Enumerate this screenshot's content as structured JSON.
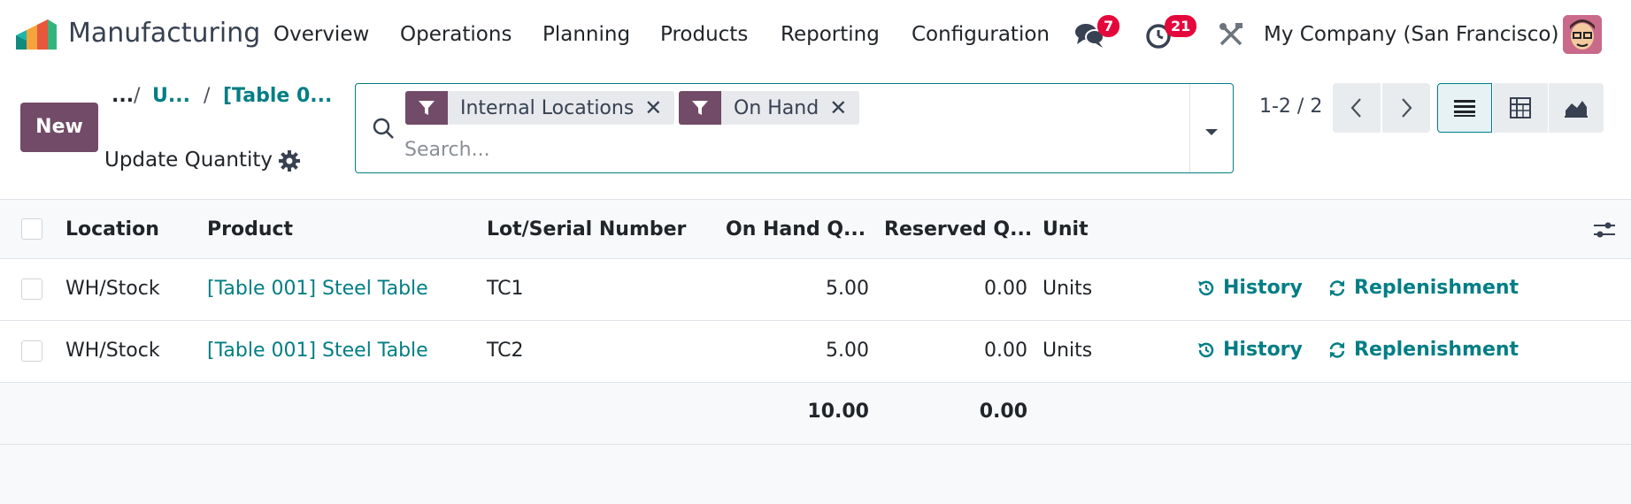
{
  "app": {
    "title": "Manufacturing",
    "accent": "#714b67",
    "link_color": "#017e84"
  },
  "nav": {
    "items": [
      "Overview",
      "Operations",
      "Planning",
      "Products",
      "Reporting",
      "Configuration"
    ],
    "messages_count": "7",
    "activities_count": "21",
    "company": "My Company (San Francisco)"
  },
  "control": {
    "new_label": "New",
    "breadcrumb": {
      "ellipsis": "...",
      "sep": "/",
      "item1": "U...",
      "item2": "[Table 0..."
    },
    "action_label": "Update Quantity",
    "search": {
      "facets": [
        {
          "label": "Internal Locations"
        },
        {
          "label": "On Hand"
        }
      ],
      "placeholder": "Search..."
    },
    "pager": "1-2 / 2"
  },
  "table": {
    "columns": {
      "location": "Location",
      "product": "Product",
      "lot": "Lot/Serial Number",
      "on_hand": "On Hand Q...",
      "reserved": "Reserved Q...",
      "unit": "Unit"
    },
    "rows": [
      {
        "location": "WH/Stock",
        "product": "[Table 001] Steel Table",
        "lot": "TC1",
        "on_hand": "5.00",
        "reserved": "0.00",
        "unit": "Units",
        "history": "History",
        "replenishment": "Replenishment"
      },
      {
        "location": "WH/Stock",
        "product": "[Table 001] Steel Table",
        "lot": "TC2",
        "on_hand": "5.00",
        "reserved": "0.00",
        "unit": "Units",
        "history": "History",
        "replenishment": "Replenishment"
      }
    ],
    "totals": {
      "on_hand": "10.00",
      "reserved": "0.00"
    }
  }
}
